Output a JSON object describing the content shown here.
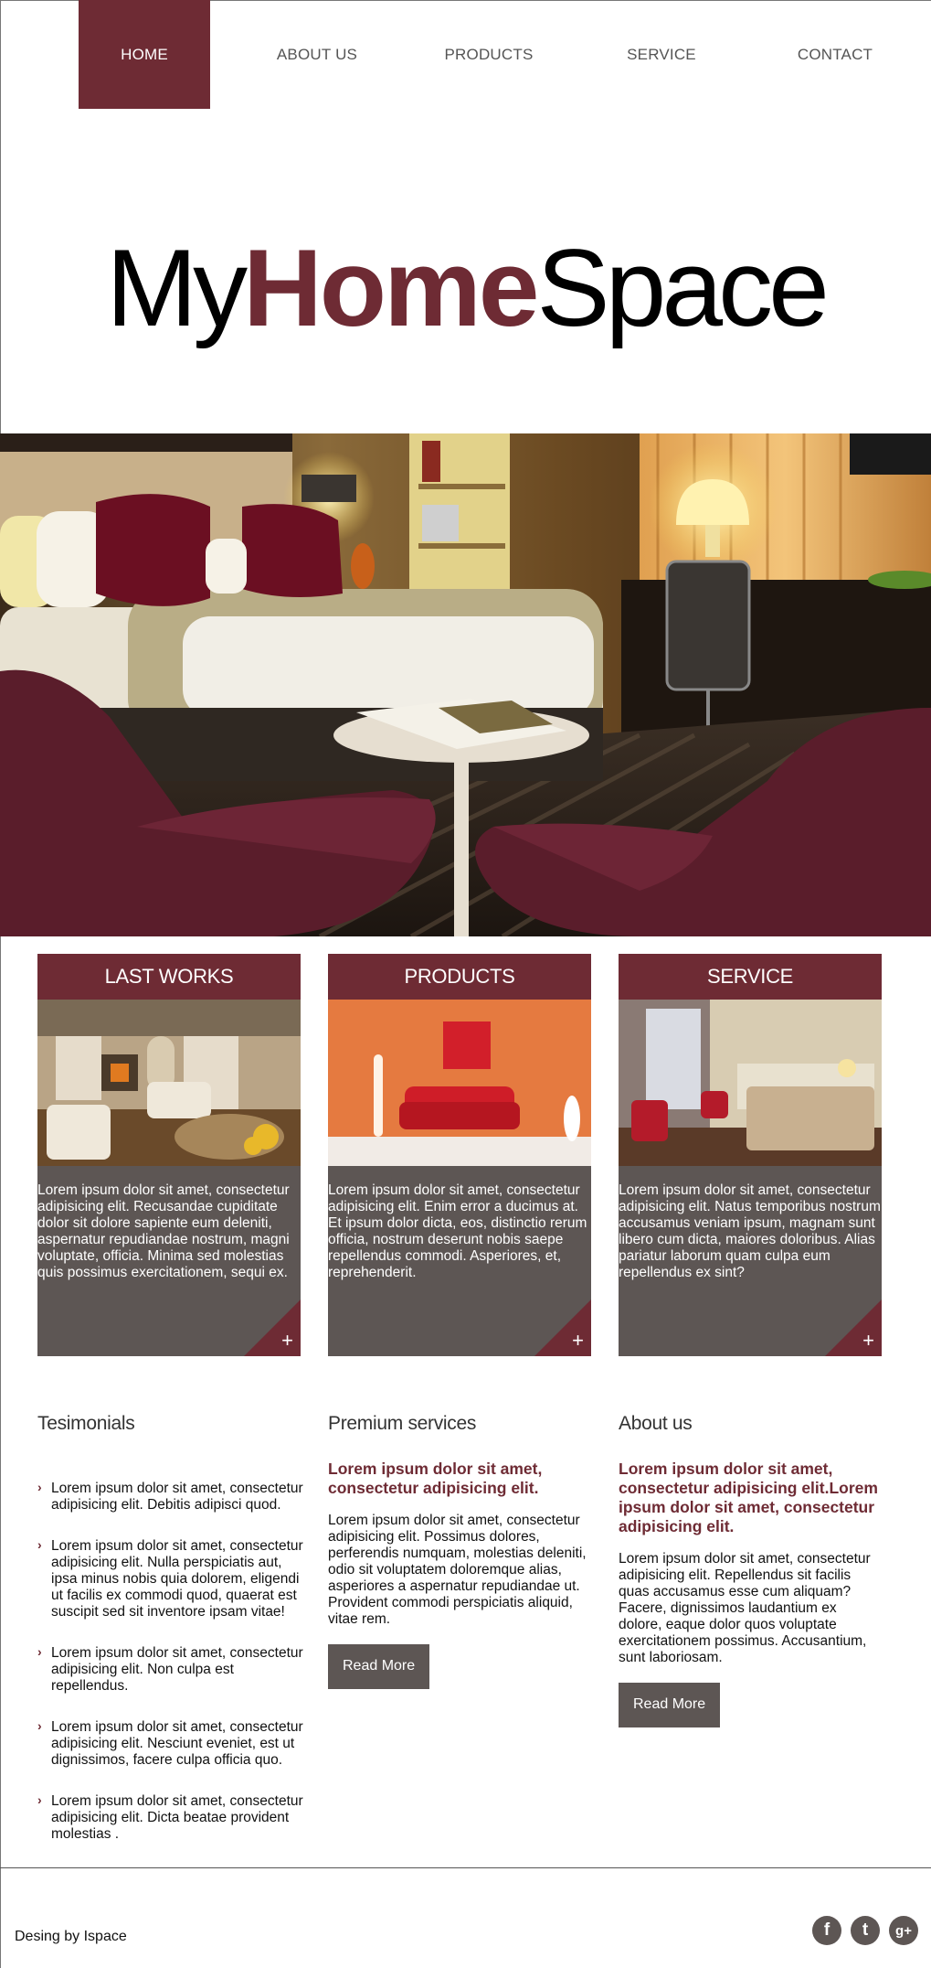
{
  "nav": {
    "items": [
      {
        "label": "HOME",
        "active": true
      },
      {
        "label": "ABOUT US"
      },
      {
        "label": "PRODUCTS"
      },
      {
        "label": "SERVICE"
      },
      {
        "label": "CONTACT"
      }
    ]
  },
  "logo": {
    "part1": "My",
    "part2": "Home",
    "part3": "Space"
  },
  "colors": {
    "accent": "#6e2b34",
    "panel": "#5d5654"
  },
  "cards": [
    {
      "title": "LAST WORKS",
      "text": "Lorem ipsum dolor sit amet, consectetur adipisicing elit. Recusandae cupiditate dolor sit dolore sapiente eum deleniti, aspernatur repudiandae nostrum, magni voluptate, officia. Minima sed molestias quis possimus exercitationem, sequi ex.",
      "icon": "plus-icon"
    },
    {
      "title": "PRODUCTS",
      "text": "Lorem ipsum dolor sit amet, consectetur adipisicing elit. Enim error a ducimus at. Et ipsum dolor dicta, eos, distinctio rerum officia, nostrum deserunt nobis saepe repellendus commodi. Asperiores, et, reprehenderit.",
      "icon": "plus-icon"
    },
    {
      "title": "SERVICE",
      "text": "Lorem ipsum dolor sit amet, consectetur adipisicing elit. Natus temporibus nostrum accusamus veniam ipsum, magnam sunt libero cum dicta, maiores doloribus. Alias pariatur laborum quam culpa eum repellendus ex sint?",
      "icon": "plus-icon"
    }
  ],
  "testimonials": {
    "title": "Tesimonials",
    "items": [
      "Lorem ipsum dolor sit amet, consectetur adipisicing elit. Debitis adipisci quod.",
      "Lorem ipsum dolor sit amet, consectetur adipisicing elit. Nulla perspiciatis aut, ipsa minus nobis quia dolorem, eligendi ut facilis ex commodi quod, quaerat est suscipit sed sit inventore ipsam vitae!",
      "Lorem ipsum dolor sit amet, consectetur adipisicing elit. Non culpa est repellendus.",
      "Lorem ipsum dolor sit amet, consectetur adipisicing elit. Nesciunt eveniet, est ut dignissimos, facere culpa officia quo.",
      "Lorem ipsum dolor sit amet, consectetur adipisicing elit. Dicta beatae provident molestias ."
    ]
  },
  "premium": {
    "title": "Premium services",
    "lead": "Lorem ipsum dolor sit amet, consectetur adipisicing elit.",
    "body": "Lorem ipsum dolor sit amet, consectetur adipisicing elit. Possimus dolores, perferendis numquam, molestias deleniti, odio sit voluptatem doloremque alias, asperiores a aspernatur repudiandae ut. Provident commodi perspiciatis aliquid, vitae rem.",
    "button": "Read More"
  },
  "about": {
    "title": "About us",
    "lead": "Lorem ipsum dolor sit amet, consectetur adipisicing elit.Lorem ipsum dolor sit amet, consectetur adipisicing elit.",
    "body": "Lorem ipsum dolor sit amet, consectetur adipisicing elit. Repellendus sit facilis quas accusamus esse cum aliquam? Facere, dignissimos laudantium ex dolore, eaque dolor quos voluptate exercitationem possimus. Accusantium, sunt laboriosam.",
    "button": "Read More"
  },
  "footer": {
    "credit": "Desing by Ispace",
    "social": [
      {
        "icon": "facebook-icon",
        "glyph": "f"
      },
      {
        "icon": "twitter-icon",
        "glyph": "t"
      },
      {
        "icon": "google-plus-icon",
        "glyph": "g+"
      }
    ]
  }
}
